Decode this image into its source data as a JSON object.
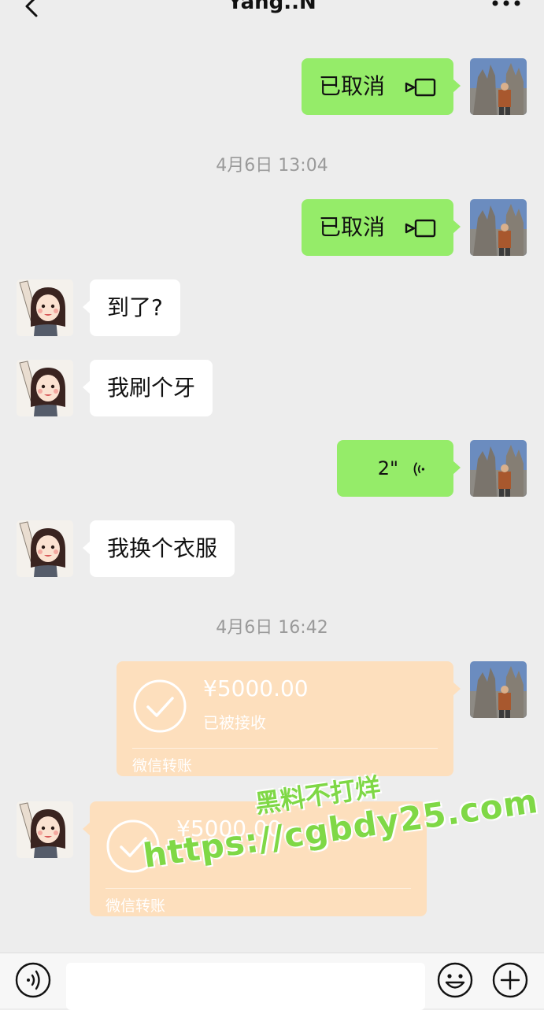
{
  "header": {
    "title": "Yang..N"
  },
  "messages": {
    "call1": {
      "text": "已取消"
    },
    "ts1": {
      "text": "4月6日 13:04"
    },
    "call2": {
      "text": "已取消"
    },
    "msg1": {
      "text": "到了?"
    },
    "msg2": {
      "text": "我刷个牙"
    },
    "voice": {
      "duration": "2\""
    },
    "msg3": {
      "text": "我换个衣服"
    },
    "ts2": {
      "text": "4月6日 16:42"
    },
    "transfer1": {
      "amount": "¥5000.00",
      "status": "已被接收",
      "footer": "微信转账"
    },
    "transfer2": {
      "amount": "¥5000.00",
      "footer": "微信转账"
    }
  },
  "watermark": {
    "line1": "黑料不打烊",
    "line2": "https://cgbdy25.com"
  },
  "colors": {
    "outgoing": "#95ec69",
    "incoming": "#ffffff",
    "transfer": "#fddfbd",
    "background": "#ededed"
  }
}
